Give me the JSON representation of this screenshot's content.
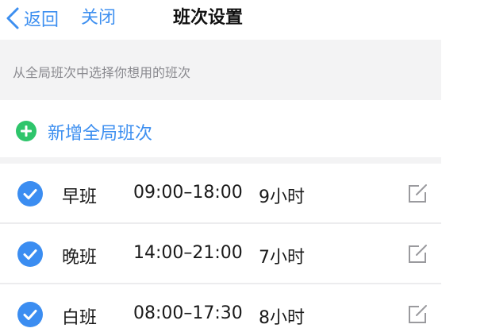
{
  "header": {
    "back_label": "返回",
    "close_label": "关闭",
    "title": "班次设置"
  },
  "hint": {
    "text": "从全局班次中选择你想用的班次"
  },
  "add": {
    "label": "新增全局班次"
  },
  "shifts": [
    {
      "name": "早班",
      "time": "09:00–18:00",
      "hours": "9小时",
      "selected": true
    },
    {
      "name": "晚班",
      "time": "14:00–21:00",
      "hours": "7小时",
      "selected": true
    },
    {
      "name": "白班",
      "time": "08:00–17:30",
      "hours": "8小时",
      "selected": true
    }
  ],
  "colors": {
    "accent": "#3d8ff0",
    "check": "#3b8df1",
    "add": "#2ec56b",
    "hint_bg": "#f3f3f4",
    "edit_icon": "#9a9a9e"
  },
  "icons": {
    "back": "chevron-left-icon",
    "add": "plus-circle-icon",
    "check": "check-circle-icon",
    "edit": "edit-icon"
  }
}
